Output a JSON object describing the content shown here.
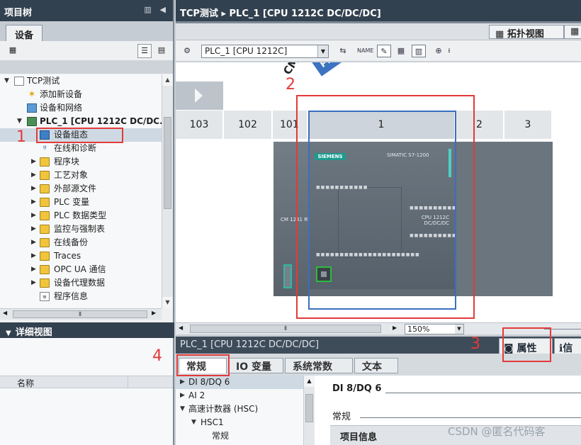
{
  "project_tree": {
    "title": "项目树",
    "devices_tab": "设备",
    "items": [
      {
        "label": "TCP测试",
        "icon": "project-icon",
        "twisty": "▼"
      },
      {
        "label": "添加新设备",
        "icon": "add-device-icon",
        "twisty": ""
      },
      {
        "label": "设备和网络",
        "icon": "network-icon",
        "twisty": ""
      },
      {
        "label": "PLC_1 [CPU 1212C DC/DC...",
        "icon": "cpu-icon",
        "twisty": "▼"
      },
      {
        "label": "设备组态",
        "icon": "device-config-icon",
        "twisty": ""
      },
      {
        "label": "在线和诊断",
        "icon": "diagnostics-icon",
        "twisty": ""
      },
      {
        "label": "程序块",
        "icon": "folder-icon",
        "twisty": "▶"
      },
      {
        "label": "工艺对象",
        "icon": "folder-icon",
        "twisty": "▶"
      },
      {
        "label": "外部源文件",
        "icon": "folder-icon",
        "twisty": "▶"
      },
      {
        "label": "PLC 变量",
        "icon": "folder-icon",
        "twisty": "▶"
      },
      {
        "label": "PLC 数据类型",
        "icon": "folder-icon",
        "twisty": "▶"
      },
      {
        "label": "监控与强制表",
        "icon": "folder-icon",
        "twisty": "▶"
      },
      {
        "label": "在线备份",
        "icon": "folder-icon",
        "twisty": "▶"
      },
      {
        "label": "Traces",
        "icon": "folder-icon",
        "twisty": "▶"
      },
      {
        "label": "OPC UA 通信",
        "icon": "folder-icon",
        "twisty": "▶"
      },
      {
        "label": "设备代理数据",
        "icon": "folder-icon",
        "twisty": "▶"
      },
      {
        "label": "程序信息",
        "icon": "info-icon",
        "twisty": ""
      }
    ]
  },
  "detail_view": {
    "title": "详细视图",
    "column_name": "名称"
  },
  "editor": {
    "breadcrumb": "TCP测试 ▸ PLC_1 [CPU 1212C DC/DC/DC]",
    "topology_tab": "拓扑视图",
    "device_select": "PLC_1 [CPU 1212C]",
    "zoom": "150%",
    "rail_label": "CM",
    "rail_tag": "PL",
    "slots": [
      "103",
      "102",
      "101",
      "1",
      "2",
      "3"
    ],
    "cm_module_text": "CM 1241 RS422/485",
    "cpu": {
      "brand": "SIEMENS",
      "family": "SIMATIC S7-1200",
      "model": "CPU 1212C DC/DC/DC"
    }
  },
  "inspector": {
    "title": "PLC_1 [CPU 1212C DC/DC/DC]",
    "properties_tab": "属性",
    "info_tab": "信",
    "tabs": [
      "常规",
      "IO 变量",
      "系统常数",
      "文本"
    ],
    "tree": [
      {
        "label": "DI 8/DQ 6",
        "twisty": "▶"
      },
      {
        "label": "AI 2",
        "twisty": "▶"
      },
      {
        "label": "高速计数器 (HSC)",
        "twisty": "▼"
      },
      {
        "label": "HSC1",
        "twisty": "▼"
      },
      {
        "label": "常规",
        "twisty": ""
      }
    ],
    "heading": "DI 8/DQ 6",
    "subheading": "常规",
    "section": "项目信息"
  },
  "annotations": [
    "1",
    "2",
    "3",
    "4"
  ],
  "watermark": "CSDN @匿名代码客"
}
